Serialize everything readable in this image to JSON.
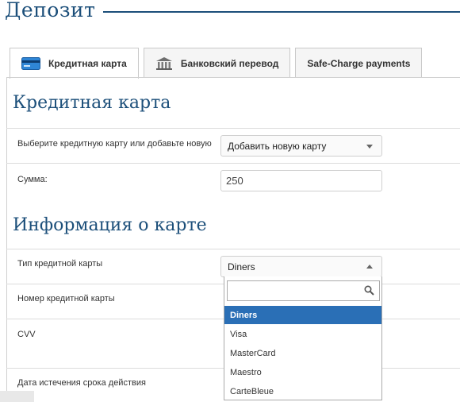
{
  "header": {
    "title": "Депозит"
  },
  "tabs": [
    {
      "label": "Кредитная карта",
      "icon": "credit-card-icon",
      "active": true
    },
    {
      "label": "Банковский перевод",
      "icon": "bank-icon",
      "active": false
    },
    {
      "label": "Safe-Charge payments",
      "active": false
    }
  ],
  "credit_card": {
    "section_title": "Кредитная карта",
    "choose_label": "Выберите кредитную карту или добавьте новую",
    "choose_value": "Добавить новую карту",
    "amount_label": "Сумма:",
    "amount_value": "250"
  },
  "card_info": {
    "section_title": "Информация о карте",
    "type_label": "Тип кредитной карты",
    "type_value": "Diners",
    "number_label": "Номер кредитной карты",
    "cvv_label": "CVV",
    "expiry_label": "Дата истечения срока действия"
  },
  "dropdown": {
    "search_value": "",
    "options": [
      "Diners",
      "Visa",
      "MasterCard",
      "Maestro",
      "CarteBleue"
    ],
    "selected": "Diners"
  },
  "colors": {
    "accent": "#1c4f7a",
    "selected": "#2a6fb6"
  }
}
